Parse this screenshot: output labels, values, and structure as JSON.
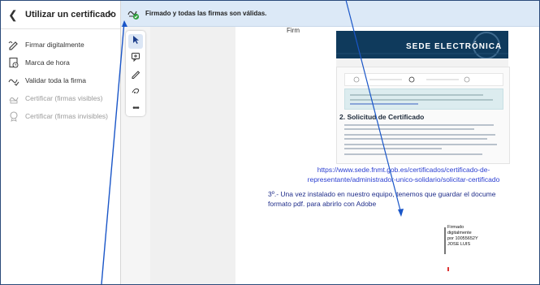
{
  "sidebar": {
    "title": "Utilizar un certificado",
    "back_icon": "chevron-left-icon",
    "close_icon": "close-icon",
    "items": [
      {
        "label": "Firmar digitalmente",
        "icon": "pen-sign-icon",
        "enabled": true
      },
      {
        "label": "Marca de hora",
        "icon": "clock-stamp-icon",
        "enabled": true
      },
      {
        "label": "Validar toda la firma",
        "icon": "validate-signature-icon",
        "enabled": true
      },
      {
        "label": "Certificar (firmas visibles)",
        "icon": "certify-visible-icon",
        "enabled": false
      },
      {
        "label": "Certificar (firmas invisibles)",
        "icon": "certify-invisible-icon",
        "enabled": false
      }
    ]
  },
  "topbar": {
    "message": "Firmado y todas las firmas son válidas.",
    "icon": "signed-valid-icon"
  },
  "tools": [
    {
      "name": "select-tool",
      "icon": "cursor-icon",
      "active": true
    },
    {
      "name": "comment-tool",
      "icon": "comment-add-icon",
      "active": false
    },
    {
      "name": "draw-tool",
      "icon": "pencil-icon",
      "active": false
    },
    {
      "name": "highlight-tool",
      "icon": "eraser-draw-icon",
      "active": false
    },
    {
      "name": "more-tool",
      "icon": "more-icon",
      "active": false
    }
  ],
  "document": {
    "top_fragment": "Firm",
    "banner_title": "SEDE ELECTRÓNICA",
    "heading": "2. Solicitud de Certificado",
    "url_line1": "https://www.sede.fnmt.gob.es/certificados/certificado-de-",
    "url_line2": "representante/administrador-unico-solidario/solicitar-certificado",
    "paragraph_line1": "3º.- Una vez instalado en nuestro equipo, tenemos que guardar el docume",
    "paragraph_line2": "formato pdf. para abrirlo con Adobe",
    "signature": [
      "Firmado",
      "digitalmente",
      "por 10055652Y",
      "JOSE LUIS"
    ]
  },
  "colors": {
    "accent": "#1a56c8",
    "banner": "#0f3a5c",
    "url": "#2b3fd1",
    "paragraph": "#1f2d8a",
    "notice_bg": "#dce9f7",
    "valid_green": "#2e9e3e"
  }
}
